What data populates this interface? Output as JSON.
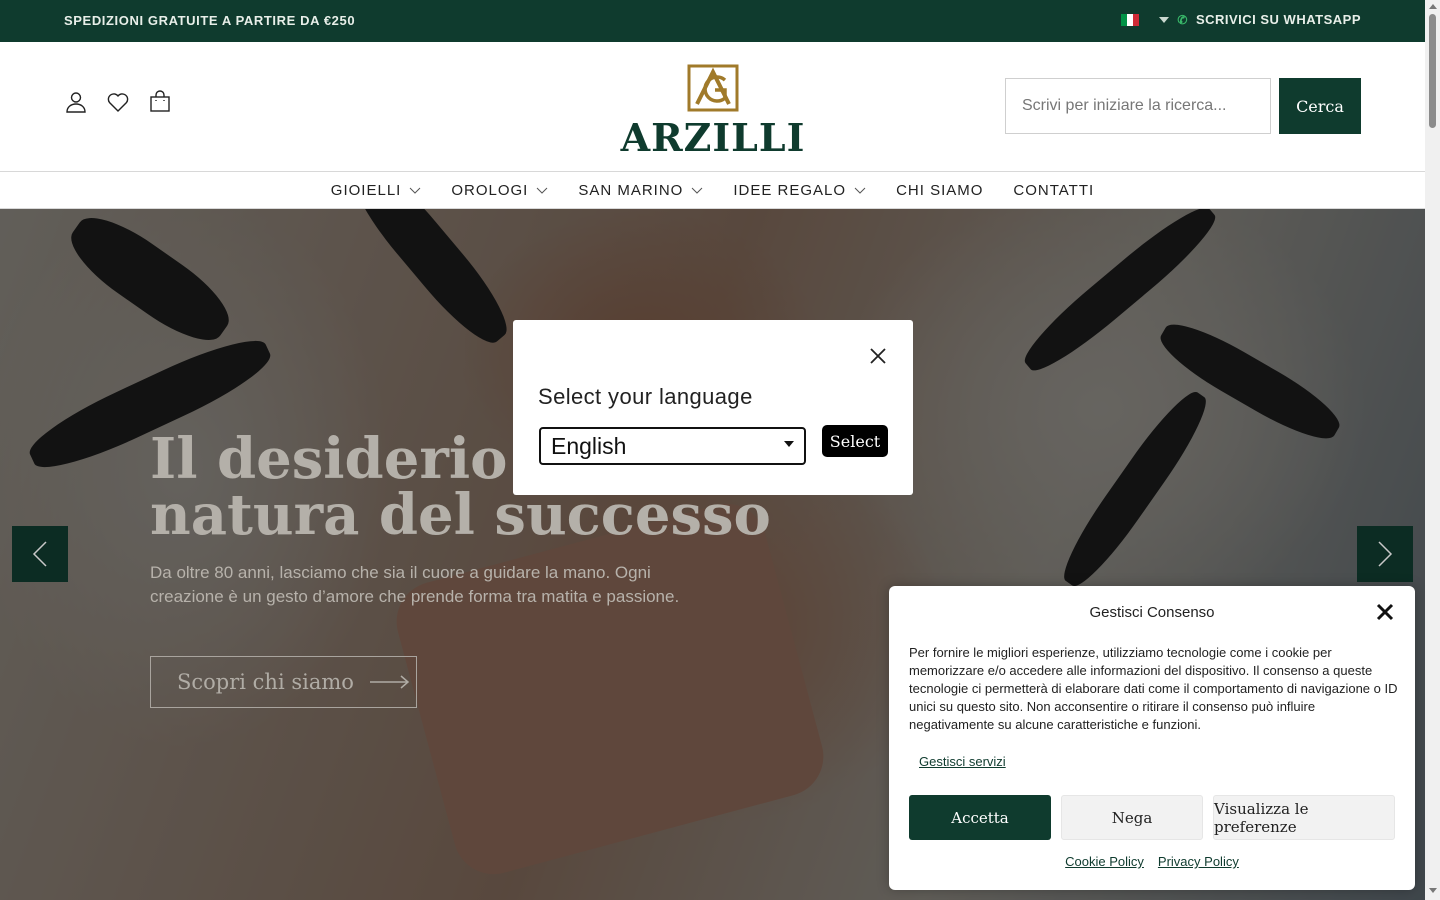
{
  "topbar": {
    "shipping": "SPEDIZIONI GRATUITE A PARTIRE DA €250",
    "whatsapp": "SCRIVICI SU WHATSAPP",
    "flag_colors": [
      "#009246",
      "#ffffff",
      "#ce2b37"
    ]
  },
  "header": {
    "icons": [
      "user-icon",
      "heart-icon",
      "bag-icon"
    ],
    "logo_text": "ARZILLI",
    "search_placeholder": "Scrivi per iniziare la ricerca...",
    "search_button": "Cerca"
  },
  "nav": {
    "items": [
      {
        "label": "GIOIELLI",
        "dropdown": true
      },
      {
        "label": "OROLOGI",
        "dropdown": true
      },
      {
        "label": "SAN MARINO",
        "dropdown": true
      },
      {
        "label": "IDEE REGALO",
        "dropdown": true
      },
      {
        "label": "CHI SIAMO",
        "dropdown": false
      },
      {
        "label": "CONTATTI",
        "dropdown": false
      }
    ]
  },
  "hero": {
    "title_line1": "Il desiderio è la",
    "title_line2": "natura del successo",
    "subtitle": "Da oltre 80 anni, lasciamo che sia il cuore a guidare la mano. Ogni creazione è un gesto d’amore che prende forma tra matita e passione.",
    "cta": "Scopri chi siamo"
  },
  "language_modal": {
    "title": "Select your language",
    "selected": "English",
    "button": "Select"
  },
  "consent": {
    "title": "Gestisci Consenso",
    "text": "Per fornire le migliori esperienze, utilizziamo tecnologie come i cookie per memorizzare e/o accedere alle informazioni del dispositivo. Il consenso a queste tecnologie ci permetterà di elaborare dati come il comportamento di navigazione o ID unici su questo sito. Non acconsentire o ritirare il consenso può influire negativamente su alcune caratteristiche e funzioni.",
    "manage_link": "Gestisci servizi",
    "accept": "Accetta",
    "deny": "Nega",
    "prefs": "Visualizza le preferenze",
    "cookie_policy": "Cookie Policy",
    "privacy_policy": "Privacy Policy"
  },
  "colors": {
    "brand_green": "#0f3b2e",
    "logo_gold": "#a07a2a"
  }
}
